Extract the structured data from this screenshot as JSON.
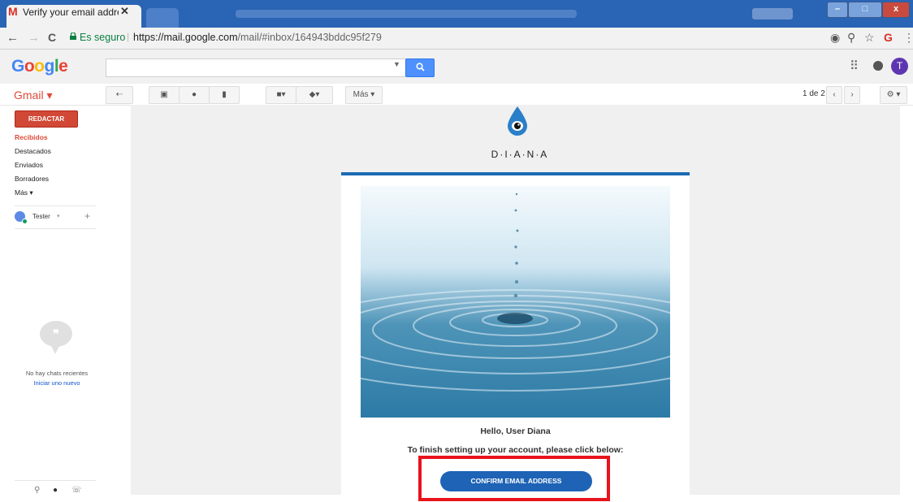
{
  "browser": {
    "tab_title": "Verify your email address",
    "tab_favicon": "M",
    "tab_close": "✕",
    "nav": {
      "back": "←",
      "forward": "→",
      "reload": "C"
    },
    "secure_label": "Es seguro",
    "url_host": "https://mail.google.com",
    "url_path": "/mail/#inbox/164943bddc95f279",
    "window_controls": {
      "minimize": "–",
      "maximize": "□",
      "close": "x"
    }
  },
  "google_header": {
    "logo": "Google",
    "search_placeholder": "",
    "search_button_icon": "search-icon",
    "avatar_initial": "T"
  },
  "gmail_bar": {
    "app_label": "Gmail ▾",
    "more_label": "Más ▾",
    "pager_text": "1 de 2",
    "pager_prev": "‹",
    "pager_next": "›",
    "settings_icon": "⚙ ▾"
  },
  "sidebar": {
    "compose_label": "REDACTAR",
    "items": [
      "Recibidos",
      "Destacados",
      "Enviados",
      "Borradores",
      "Más ▾"
    ],
    "user_name": "Tester",
    "add_user": "+",
    "hangouts_empty": "No hay chats recientes",
    "hangouts_start": "Iniciar uno nuevo"
  },
  "email": {
    "brand": "D·I·A·N·A",
    "greeting": "Hello, User Diana",
    "instruction": "To finish setting up your account, please click below:",
    "confirm_button": "CONFIRM EMAIL ADDRESS"
  },
  "colors": {
    "accent_blue": "#1e63b5",
    "gmail_red": "#dd4b39",
    "highlight_red": "#e8131b"
  }
}
